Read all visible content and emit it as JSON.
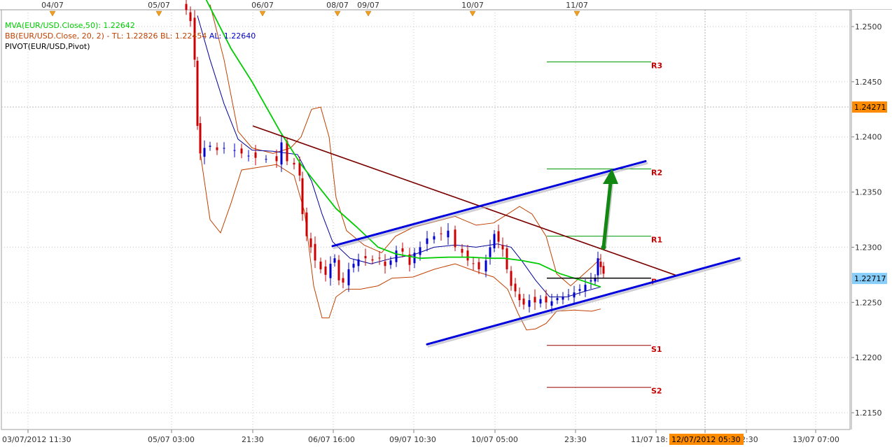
{
  "chart_data": {
    "type": "line",
    "indicators": [
      {
        "text": "MVA(EUR/USD.Close,50): 1.22642",
        "color": "#00cc00"
      },
      {
        "text": "BB(EUR/USD.Close, 20, 2) -  TL: 1.22826  BL: 1.22454",
        "color": "#c04000"
      },
      {
        "text": "AL: 1.22640",
        "color": "#0000cc"
      },
      {
        "text": "PIVOT(EUR/USD,Pivot)",
        "color": "#000000"
      }
    ],
    "top_date_markers": [
      "04/07",
      "05/07",
      "06/07",
      "08/07",
      "09/07",
      "10/07",
      "11/07"
    ],
    "x_tick_labels": [
      "03/07/2012 11:30",
      "05/07 03:00",
      "21:30",
      "06/07 16:00",
      "09/07 10:30",
      "10/07 05:00",
      "23:30",
      "11/07 18:",
      "12/07/2012 05:30",
      "2:30",
      "13/07 07:00"
    ],
    "y_tick_labels": [
      "1.2500",
      "1.2450",
      "1.2400",
      "1.2350",
      "1.2300",
      "1.2250",
      "1.2200",
      "1.2150"
    ],
    "ylim": [
      1.2145,
      1.2505
    ],
    "price_tags": [
      {
        "text": "1.24271",
        "value": 1.24271,
        "bg": "#ff8c00"
      },
      {
        "text": "1.22717",
        "value": 1.22717,
        "bg": "#87cefa"
      }
    ],
    "pivot_levels": [
      {
        "label": "R3",
        "value": 1.2468,
        "color": "#009900"
      },
      {
        "label": "R2",
        "value": 1.2371,
        "color": "#009900"
      },
      {
        "label": "R1",
        "value": 1.231,
        "color": "#009900"
      },
      {
        "label": "P",
        "value": 1.2272,
        "color": "#000000"
      },
      {
        "label": "S1",
        "value": 1.2211,
        "color": "#990000"
      },
      {
        "label": "S2",
        "value": 1.2173,
        "color": "#990000"
      }
    ],
    "label_color": "#cc0000",
    "cursor_time_label": "12/07/2012 05:30",
    "colors": {
      "up_candle": "#0000cc",
      "down_candle": "#cc0000",
      "moving_average": "#00cc00",
      "bollinger": "#c04000",
      "average_line": "#000099",
      "channel": "#0000dd",
      "downtrend": "#7a0000",
      "target_arrow": "#128812",
      "grid": "#c8c8c8",
      "cursor_tag": "#ff8c00"
    },
    "grid": true,
    "channel_lines": [
      [
        [
          475,
          1.2301
        ],
        [
          922,
          1.2378
        ]
      ],
      [
        [
          610,
          1.2212
        ],
        [
          1056,
          1.229
        ]
      ]
    ],
    "downtrend_line": [
      [
        361,
        1.241
      ],
      [
        968,
        1.2274
      ]
    ],
    "target_arrow": {
      "from": [
        862,
        1.23
      ],
      "to": [
        872,
        1.237
      ]
    },
    "ma_series": [
      [
        294,
        1.2525
      ],
      [
        330,
        1.248
      ],
      [
        360,
        1.245
      ],
      [
        400,
        1.2405
      ],
      [
        430,
        1.2375
      ],
      [
        455,
        1.2355
      ],
      [
        480,
        1.2335
      ],
      [
        510,
        1.2318
      ],
      [
        540,
        1.23
      ],
      [
        565,
        1.2294
      ],
      [
        600,
        1.229
      ],
      [
        640,
        1.2291
      ],
      [
        670,
        1.2291
      ],
      [
        700,
        1.229
      ],
      [
        720,
        1.229
      ],
      [
        745,
        1.2288
      ],
      [
        770,
        1.2285
      ],
      [
        800,
        1.2276
      ],
      [
        830,
        1.227
      ],
      [
        858,
        1.2264
      ]
    ],
    "bb_upper": [
      [
        300,
        1.252
      ],
      [
        320,
        1.247
      ],
      [
        340,
        1.2405
      ],
      [
        360,
        1.239
      ],
      [
        390,
        1.2385
      ],
      [
        415,
        1.239
      ],
      [
        430,
        1.24
      ],
      [
        445,
        1.2425
      ],
      [
        458,
        1.2427
      ],
      [
        470,
        1.24
      ],
      [
        480,
        1.2345
      ],
      [
        495,
        1.2315
      ],
      [
        520,
        1.2302
      ],
      [
        545,
        1.2295
      ],
      [
        565,
        1.231
      ],
      [
        590,
        1.2318
      ],
      [
        620,
        1.2323
      ],
      [
        650,
        1.2328
      ],
      [
        680,
        1.232
      ],
      [
        705,
        1.2322
      ],
      [
        725,
        1.233
      ],
      [
        742,
        1.2337
      ],
      [
        760,
        1.233
      ],
      [
        780,
        1.231
      ],
      [
        795,
        1.2276
      ],
      [
        815,
        1.2265
      ],
      [
        845,
        1.2282
      ],
      [
        858,
        1.229
      ]
    ],
    "bb_lower": [
      [
        285,
        1.239
      ],
      [
        300,
        1.2325
      ],
      [
        315,
        1.2313
      ],
      [
        330,
        1.234
      ],
      [
        345,
        1.237
      ],
      [
        365,
        1.2372
      ],
      [
        395,
        1.2375
      ],
      [
        420,
        1.2365
      ],
      [
        435,
        1.2332
      ],
      [
        448,
        1.2265
      ],
      [
        460,
        1.2236
      ],
      [
        470,
        1.2236
      ],
      [
        480,
        1.2255
      ],
      [
        495,
        1.2262
      ],
      [
        515,
        1.2262
      ],
      [
        540,
        1.2265
      ],
      [
        560,
        1.2272
      ],
      [
        590,
        1.2273
      ],
      [
        620,
        1.228
      ],
      [
        650,
        1.2285
      ],
      [
        680,
        1.2278
      ],
      [
        705,
        1.2273
      ],
      [
        725,
        1.2262
      ],
      [
        740,
        1.224
      ],
      [
        752,
        1.2225
      ],
      [
        765,
        1.2226
      ],
      [
        780,
        1.2231
      ],
      [
        795,
        1.2242
      ],
      [
        820,
        1.2243
      ],
      [
        845,
        1.2242
      ],
      [
        858,
        1.2244
      ]
    ],
    "al_series": [
      [
        282,
        1.251
      ],
      [
        300,
        1.247
      ],
      [
        320,
        1.243
      ],
      [
        340,
        1.2398
      ],
      [
        360,
        1.2388
      ],
      [
        390,
        1.2387
      ],
      [
        425,
        1.2384
      ],
      [
        445,
        1.236
      ],
      [
        460,
        1.233
      ],
      [
        475,
        1.2305
      ],
      [
        500,
        1.229
      ],
      [
        530,
        1.2285
      ],
      [
        560,
        1.229
      ],
      [
        590,
        1.2293
      ],
      [
        620,
        1.23
      ],
      [
        650,
        1.2302
      ],
      [
        680,
        1.23
      ],
      [
        710,
        1.2303
      ],
      [
        730,
        1.23
      ],
      [
        745,
        1.2288
      ],
      [
        765,
        1.227
      ],
      [
        785,
        1.2255
      ],
      [
        810,
        1.2255
      ],
      [
        835,
        1.226
      ],
      [
        858,
        1.2264
      ]
    ]
  }
}
